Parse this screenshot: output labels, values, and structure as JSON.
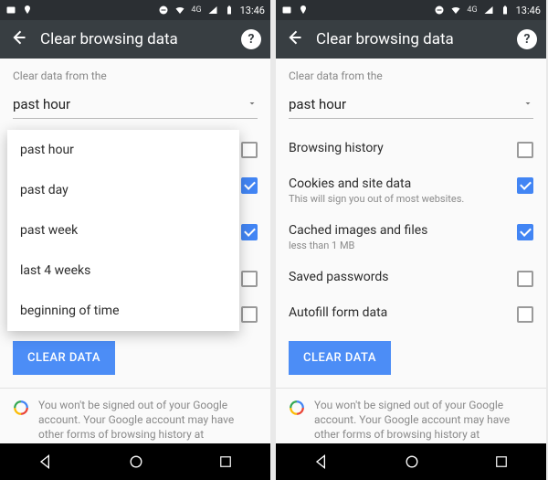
{
  "status": {
    "signal_label": "4G",
    "time": "13:46"
  },
  "appbar": {
    "title": "Clear browsing data"
  },
  "hint": "Clear data from the",
  "spinner_value": "past hour",
  "dropdown_options": [
    "past hour",
    "past day",
    "past week",
    "last 4 weeks",
    "beginning of time"
  ],
  "items": {
    "browsing_history": {
      "label": "Browsing history",
      "sub": ""
    },
    "cookies": {
      "label": "Cookies and site data",
      "sub": "This will sign you out of most websites."
    },
    "cache": {
      "label": "Cached images and files",
      "sub": "less than 1 MB"
    },
    "saved_passwords": {
      "label": "Saved passwords",
      "sub": ""
    },
    "autofill": {
      "label": "Autofill form data",
      "sub": ""
    }
  },
  "clear_button": "CLEAR DATA",
  "footer": "You won't be signed out of your Google account. Your Google account may have other forms of browsing history at"
}
